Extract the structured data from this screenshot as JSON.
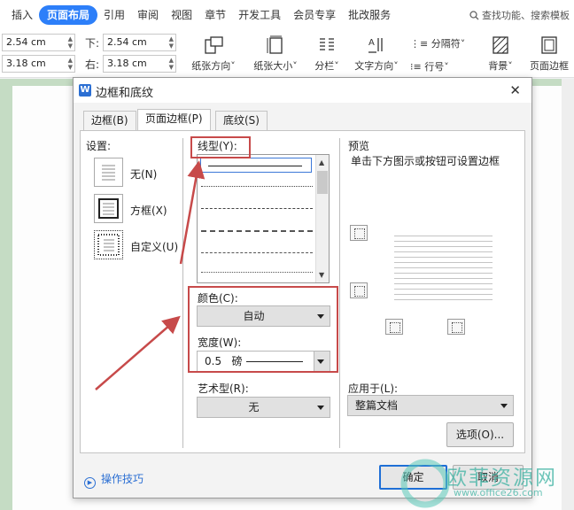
{
  "menu": {
    "items": [
      {
        "id": "insert",
        "label": "插入"
      },
      {
        "id": "layout",
        "label": "页面布局",
        "active": true
      },
      {
        "id": "ref",
        "label": "引用"
      },
      {
        "id": "review",
        "label": "审阅"
      },
      {
        "id": "view",
        "label": "视图"
      },
      {
        "id": "chapter",
        "label": "章节"
      },
      {
        "id": "devtools",
        "label": "开发工具"
      },
      {
        "id": "member",
        "label": "会员专享"
      },
      {
        "id": "annot",
        "label": "批改服务"
      }
    ],
    "search_label": "查找功能、搜索模板"
  },
  "margins": {
    "top_value": "2.54 cm",
    "left_value": "3.18 cm",
    "bottom_label": "下:",
    "bottom_value": "2.54 cm",
    "right_label": "右:",
    "right_value": "3.18 cm"
  },
  "toolbar": {
    "orientation": "纸张方向",
    "size": "纸张大小",
    "columns": "分栏",
    "text_dir": "文字方向",
    "break": "分隔符",
    "line_num": "行号",
    "background": "背景",
    "page_border": "页面边框"
  },
  "dialog": {
    "title": "边框和底纹",
    "close": "✕",
    "tabs": {
      "border": "边框(B)",
      "page_border": "页面边框(P)",
      "shading": "底纹(S)"
    },
    "setting_label": "设置:",
    "settings": {
      "none": "无(N)",
      "box": "方框(X)",
      "custom": "自定义(U)"
    },
    "style_label": "线型(Y):",
    "color_label": "颜色(C):",
    "color_value": "自动",
    "width_label": "宽度(W):",
    "width_value": "0.5",
    "width_unit": "磅",
    "art_label": "艺术型(R):",
    "art_value": "无",
    "preview_label": "预览",
    "preview_hint": "单击下方图示或按钮可设置边框",
    "apply_label": "应用于(L):",
    "apply_value": "整篇文档",
    "options_button": "选项(O)...",
    "tips": "操作技巧",
    "ok": "确定",
    "cancel": "取消"
  },
  "watermark": {
    "text": "欧菲资源网",
    "url": "www.office26.com"
  },
  "colors": {
    "accent": "#2d7ff9",
    "annotation": "#c74a4a",
    "doc_bg": "#c5dcc4"
  }
}
